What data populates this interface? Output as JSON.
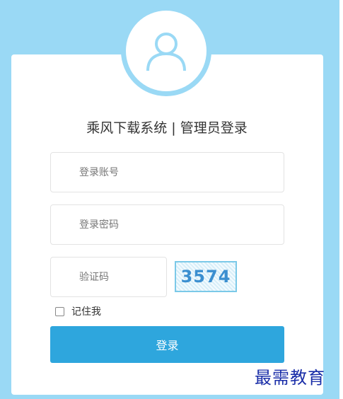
{
  "title": "乘风下载系统 | 管理员登录",
  "form": {
    "account_placeholder": "登录账号",
    "password_placeholder": "登录密码",
    "captcha_placeholder": "验证码",
    "captcha_code": "3574",
    "remember_label": "记住我",
    "submit_label": "登录"
  },
  "watermark": "最需教育",
  "colors": {
    "background": "#9ad9f5",
    "button": "#2ea6dd",
    "watermark": "#1a2ea8"
  },
  "icons": {
    "avatar": "user-icon"
  }
}
